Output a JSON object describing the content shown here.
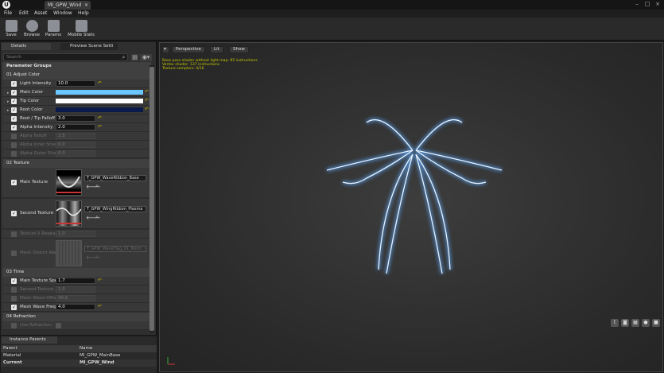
{
  "window": {
    "doc_tab": "MI_GPW_Wind",
    "close": "×",
    "min": "–",
    "max": "□",
    "winclose": "×"
  },
  "menu": [
    "File",
    "Edit",
    "Asset",
    "Window",
    "Help"
  ],
  "toolbar": [
    "Save",
    "Browse",
    "Params",
    "Mobile Stats"
  ],
  "details_tab": "Details",
  "preview_tab": "Preview Scene Setti",
  "search_placeholder": "Search",
  "parameter_groups_label": "Parameter Groups",
  "groups": {
    "g1": "01 Adjust Color",
    "g2": "02 Texture",
    "g3": "03 Time",
    "g4": "04 Refraction"
  },
  "params": {
    "light_intensity": {
      "label": "Light Intensity",
      "value": "10.0"
    },
    "main_color": {
      "label": "Main Color",
      "color": "#6cc6ff"
    },
    "tip_color": {
      "label": "Tip Color",
      "color": "#ffffff"
    },
    "root_color": {
      "label": "Root Color",
      "color": "#0a1a4a"
    },
    "root_tip_falloff": {
      "label": "Root / Tip Falloff",
      "value": "3.0"
    },
    "alpha_intensity": {
      "label": "Alpha Intensity",
      "value": "2.0"
    },
    "alpha_falloff": {
      "label": "Alpha Falloff",
      "value": "2.5"
    },
    "alpha_inner_sharp": {
      "label": "Alpha Inner Sharp",
      "value": "0.0"
    },
    "alpha_outer_sharp": {
      "label": "Alpha Outer Sharp",
      "value": "0.0"
    },
    "main_texture": {
      "label": "Main Texture",
      "asset": "T_GPW_WaveRibbon_Base"
    },
    "second_texture": {
      "label": "Second Texture",
      "asset": "T_GPW_WingRibbon_Plasma"
    },
    "texture_x_repeat": {
      "label": "Texture X Repeat",
      "value": "1.0"
    },
    "mesh_distort_wave": {
      "label": "Mesh Distort Wav",
      "asset": "T_GPW_WaveFlag_01_Norm"
    },
    "main_texture_speed": {
      "label": "Main Texture Spe",
      "value": "1.7"
    },
    "second_texture_speed": {
      "label": "Second Texture",
      "value": "1.0"
    },
    "mesh_wave_offset": {
      "label": "Mesh Wave Offse",
      "value": "40.0"
    },
    "mesh_wave_freq": {
      "label": "Mesh Wave Freq",
      "value": "4.0"
    },
    "use_refraction": {
      "label": "Use Refraction"
    }
  },
  "parents": {
    "tab": "Instance Parents",
    "headers": [
      "Parent",
      "Name"
    ],
    "rows": [
      [
        "Material",
        "MI_GPW_MainBase"
      ],
      [
        "Current",
        "MI_GPW_Wind"
      ]
    ]
  },
  "viewport": {
    "perspective": "Perspective",
    "lit": "Lit",
    "show": "Show",
    "stats": [
      "Base pass shader without light map: 85 instructions",
      "Vertex shader: 137 instructions",
      "Texture samplers: 4/16"
    ]
  }
}
